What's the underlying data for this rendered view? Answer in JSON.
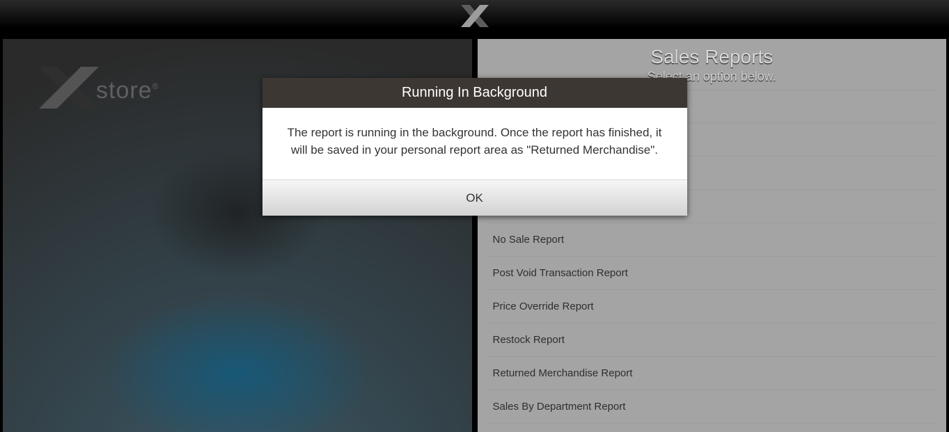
{
  "app": {
    "logo_text": "store",
    "trademark": "®"
  },
  "panel": {
    "title": "Sales Reports",
    "subtitle": "Select an option below.",
    "items": [
      "",
      "",
      "",
      "",
      "No Sale Report",
      "Post Void Transaction Report",
      "Price Override Report",
      "Restock Report",
      "Returned Merchandise Report",
      "Sales By Department Report"
    ]
  },
  "modal": {
    "title": "Running In Background",
    "message": "The report is running in the background. Once the report has finished, it will be saved in your personal report area as \"Returned Merchandise\".",
    "ok_label": "OK"
  }
}
